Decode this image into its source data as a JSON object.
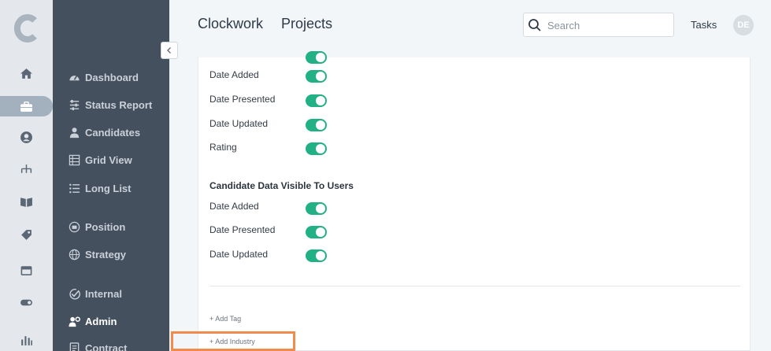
{
  "rail": {
    "logo_letter": "C",
    "items": [
      {
        "icon": "home-icon"
      },
      {
        "icon": "briefcase-icon",
        "active": true
      },
      {
        "icon": "user-circle-icon"
      },
      {
        "icon": "org-chart-icon"
      },
      {
        "icon": "book-icon"
      },
      {
        "icon": "tags-icon"
      },
      {
        "icon": "calendar-icon"
      },
      {
        "icon": "toggle-icon"
      },
      {
        "icon": "bar-chart-icon"
      }
    ]
  },
  "sidebar": {
    "items": [
      {
        "label": "Dashboard",
        "icon": "speedometer-icon"
      },
      {
        "label": "Status Report",
        "icon": "sliders-icon"
      },
      {
        "label": "Candidates",
        "icon": "person-icon"
      },
      {
        "label": "Grid View",
        "icon": "grid-list-icon"
      },
      {
        "label": "Long List",
        "icon": "list-icon"
      },
      {
        "label": "Position",
        "icon": "position-icon"
      },
      {
        "label": "Strategy",
        "icon": "globe-icon"
      },
      {
        "label": "Internal",
        "icon": "check-circle-icon"
      },
      {
        "label": "Admin",
        "icon": "user-gear-icon",
        "active": true
      },
      {
        "label": "Contract",
        "icon": "document-icon"
      }
    ]
  },
  "header": {
    "app_title": "Clockwork",
    "page_title": "Projects",
    "search_placeholder": "Search",
    "tasks_label": "Tasks",
    "avatar_initials": "DE"
  },
  "settings": {
    "client_fields": [
      {
        "label": "Date Added",
        "enabled": true
      },
      {
        "label": "Date Presented",
        "enabled": true
      },
      {
        "label": "Date Updated",
        "enabled": true
      },
      {
        "label": "Rating",
        "enabled": true
      }
    ],
    "user_section_title": "Candidate Data Visible To Users",
    "user_fields": [
      {
        "label": "Date Added",
        "enabled": true
      },
      {
        "label": "Date Presented",
        "enabled": true
      },
      {
        "label": "Date Updated",
        "enabled": true
      }
    ],
    "add_tag_label": "+ Add Tag",
    "add_industry_label": "+ Add Industry"
  },
  "colors": {
    "toggle_on": "#22b085",
    "sidebar_bg": "#45505f",
    "highlight": "#f28a4b"
  }
}
